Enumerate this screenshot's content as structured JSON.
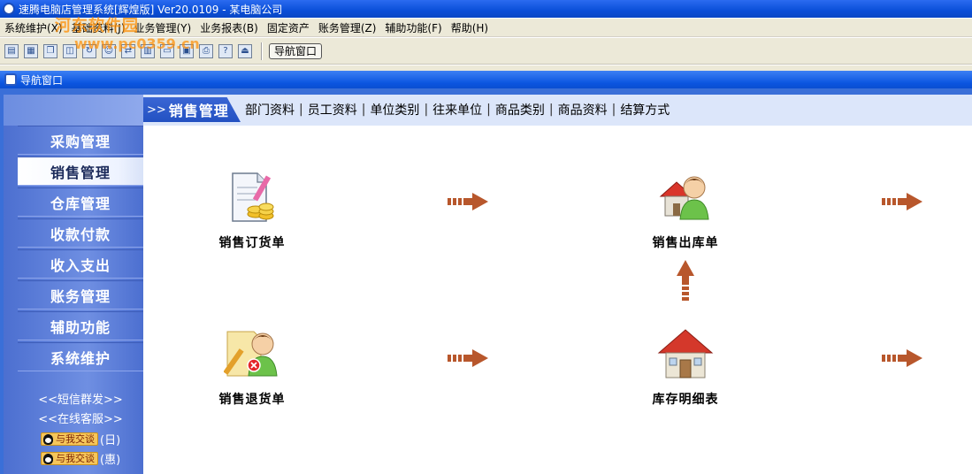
{
  "window": {
    "title": "速腾电脑店管理系统[辉煌版] Ver20.0109  -  某电脑公司"
  },
  "watermark": {
    "text": "河东软件园",
    "url": "www.pc0359.cn"
  },
  "menu": [
    {
      "label": "系统维护(X)"
    },
    {
      "label": "基础资料(J)"
    },
    {
      "label": "业务管理(Y)"
    },
    {
      "label": "业务报表(B)"
    },
    {
      "label": "固定资产"
    },
    {
      "label": "账务管理(Z)"
    },
    {
      "label": "辅助功能(F)"
    },
    {
      "label": "帮助(H)"
    }
  ],
  "toolbar": {
    "icons": [
      "new-doc-icon",
      "open-icon",
      "copy-icon",
      "print-preview-icon",
      "refresh-icon",
      "users-icon",
      "transfer-icon",
      "chart-icon",
      "window-icon",
      "save-icon",
      "printer-icon",
      "help-icon",
      "exit-icon"
    ],
    "nav_button": "导航窗口"
  },
  "navwin": {
    "title": "导航窗口"
  },
  "sidebar": {
    "items": [
      {
        "label": "采购管理"
      },
      {
        "label": "销售管理"
      },
      {
        "label": "仓库管理"
      },
      {
        "label": "收款付款"
      },
      {
        "label": "收入支出"
      },
      {
        "label": "账务管理"
      },
      {
        "label": "辅助功能"
      },
      {
        "label": "系统维护"
      }
    ],
    "active_index": 1,
    "sms": "<<短信群发>>",
    "service": "<<在线客服>>",
    "qq": [
      {
        "badge": "与我交谈",
        "suffix": "(日)"
      },
      {
        "badge": "与我交谈",
        "suffix": "(惠)"
      }
    ]
  },
  "header": {
    "arrows": ">>",
    "title": "销售管理",
    "links": [
      "部门资料",
      "员工资料",
      "单位类别",
      "往来单位",
      "商品类别",
      "商品资料",
      "结算方式"
    ],
    "separator": "|"
  },
  "main": {
    "sales_order": "销售订货单",
    "sales_outbound": "销售出库单",
    "sales_return": "销售退货单",
    "inventory_detail": "库存明细表"
  },
  "colors": {
    "title_bar": "#0a4fd8",
    "sidebar": "#5a7ed8",
    "arrow": "#b8572c"
  }
}
